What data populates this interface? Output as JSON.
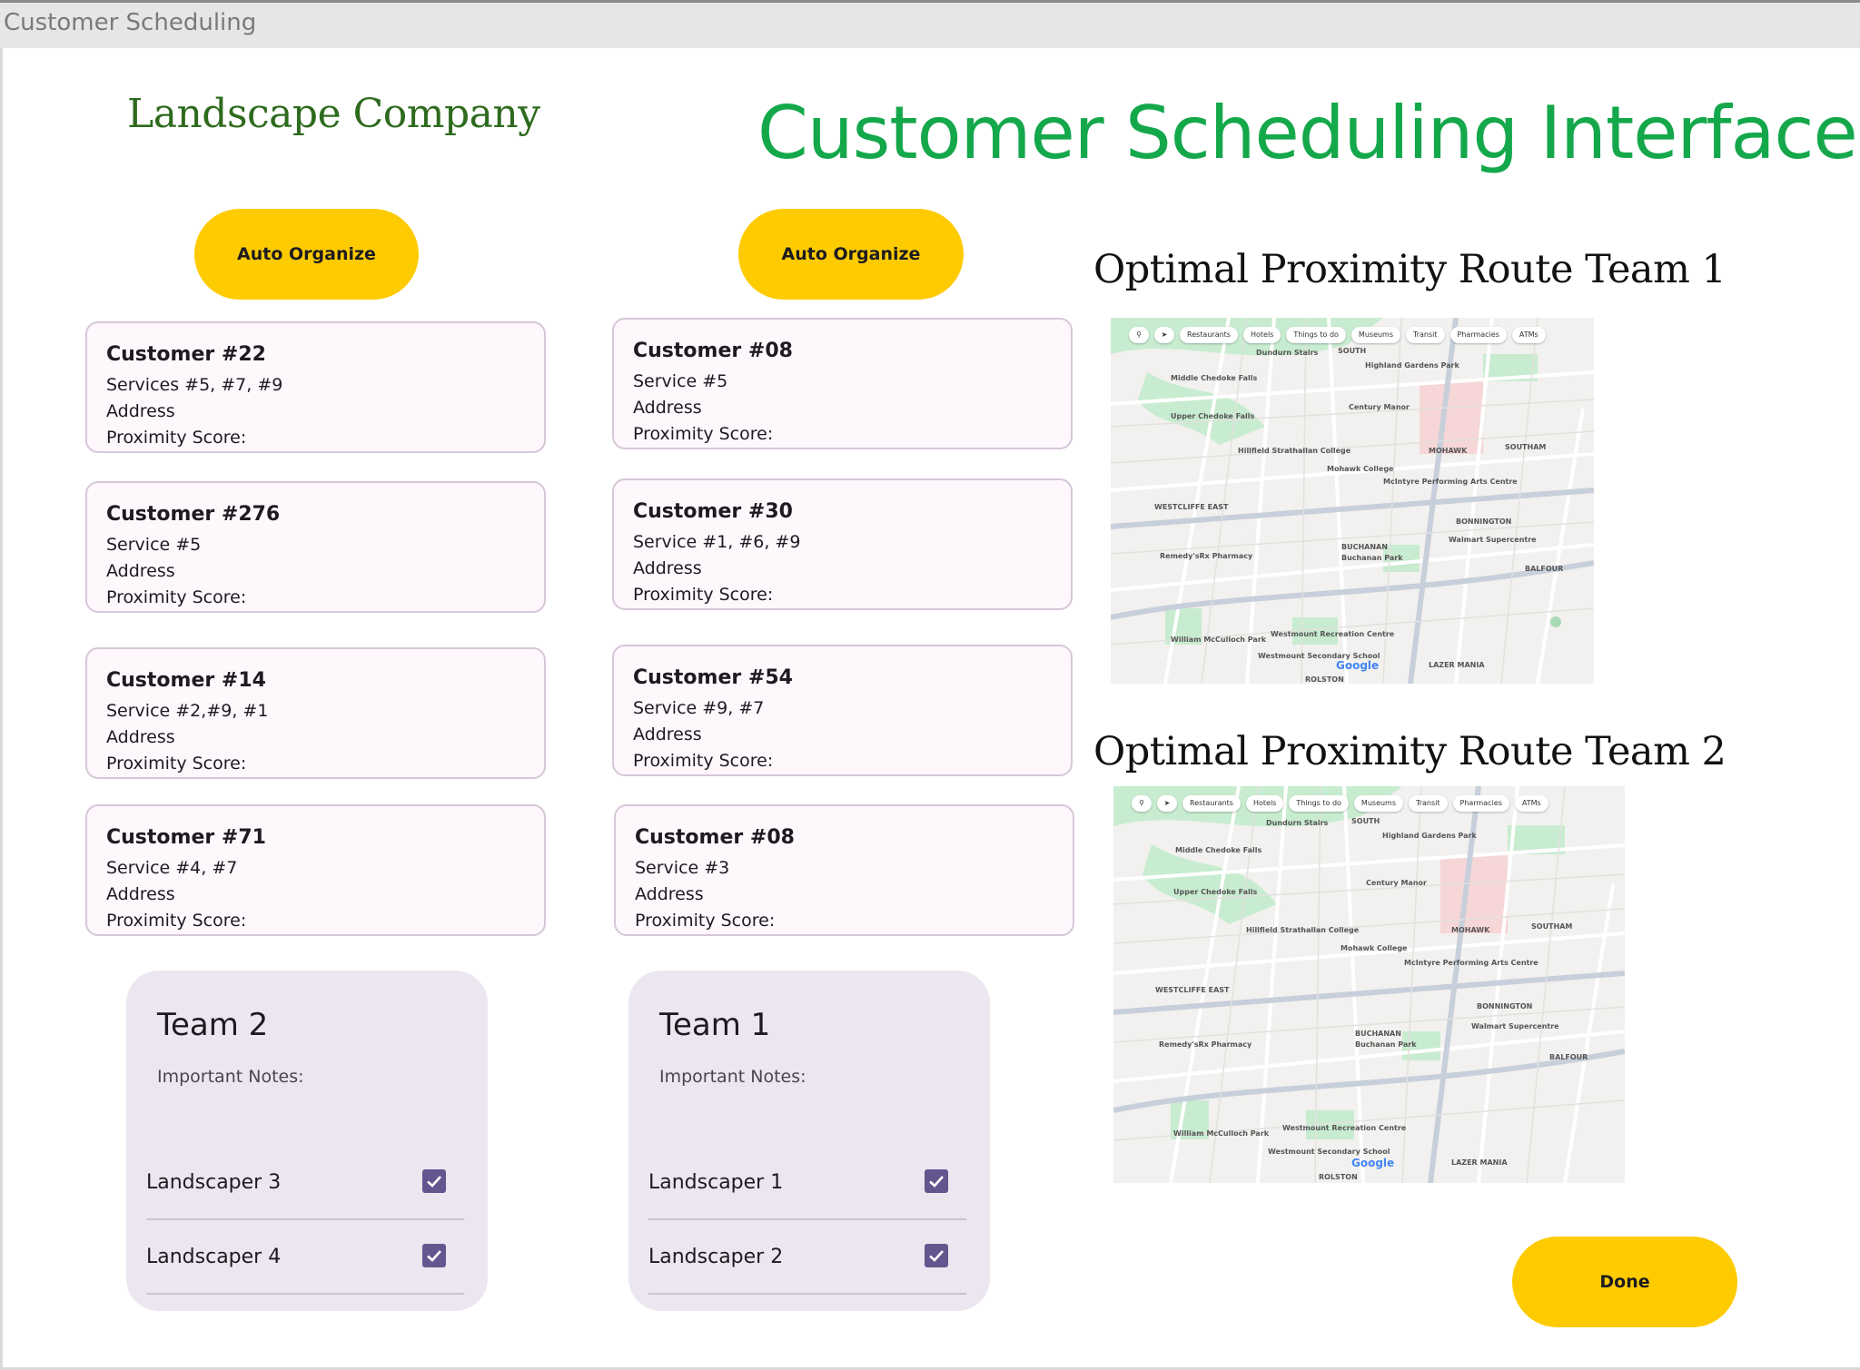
{
  "window": {
    "title": "Customer Scheduling"
  },
  "header": {
    "brand": "Landscape Company",
    "title": "Customer Scheduling Interface"
  },
  "columns": [
    {
      "auto_organize_label": "Auto Organize",
      "customers": [
        {
          "title": "Customer #22",
          "services": "Services #5, #7, #9",
          "address": "Address",
          "proximity": "Proximity Score:"
        },
        {
          "title": "Customer #276",
          "services": "Service #5",
          "address": "Address",
          "proximity": "Proximity Score:"
        },
        {
          "title": "Customer #14",
          "services": "Service #2,#9, #1",
          "address": "Address",
          "proximity": "Proximity Score:"
        },
        {
          "title": "Customer #71",
          "services": "Service #4, #7",
          "address": "Address",
          "proximity": "Proximity Score:"
        }
      ],
      "team": {
        "name": "Team 2",
        "notes_label": "Important Notes:",
        "members": [
          {
            "name": "Landscaper 3",
            "checked": true
          },
          {
            "name": "Landscaper 4",
            "checked": true
          }
        ]
      }
    },
    {
      "auto_organize_label": "Auto Organize",
      "customers": [
        {
          "title": "Customer #08",
          "services": "Service #5",
          "address": "Address",
          "proximity": "Proximity Score:"
        },
        {
          "title": "Customer #30",
          "services": "Service #1, #6, #9",
          "address": "Address",
          "proximity": "Proximity Score:"
        },
        {
          "title": "Customer #54",
          "services": "Service #9, #7",
          "address": "Address",
          "proximity": "Proximity Score:"
        },
        {
          "title": "Customer #08",
          "services": "Service #3",
          "address": "Address",
          "proximity": "Proximity Score:"
        }
      ],
      "team": {
        "name": "Team 1",
        "notes_label": "Important Notes:",
        "members": [
          {
            "name": "Landscaper 1",
            "checked": true
          },
          {
            "name": "Landscaper 2",
            "checked": true
          }
        ]
      }
    }
  ],
  "routes": [
    {
      "title": "Optimal Proximity Route Team 1"
    },
    {
      "title": "Optimal Proximity Route Team 2"
    }
  ],
  "map": {
    "chips": [
      "Restaurants",
      "Hotels",
      "Things to do",
      "Museums",
      "Transit",
      "Pharmacies",
      "ATMs"
    ],
    "places": [
      "Dundurn Stairs",
      "Middle Chedoke Falls",
      "Upper Chedoke Falls",
      "Century Manor",
      "Hillfield Strathallan College",
      "Mohawk College",
      "McIntyre Performing Arts Centre",
      "WESTCLIFFE EAST",
      "BONNINGTON",
      "Walmart Supercentre",
      "Remedy'sRx Pharmacy",
      "BUCHANAN",
      "Buchanan Park",
      "BALFOUR",
      "William McCulloch Park",
      "Westmount Recreation Centre",
      "Westmount Secondary School",
      "LAZER MANIA",
      "ROLSTON",
      "SOUTHAM",
      "MOHAWK",
      "SOUTH",
      "Highland Gardens Park"
    ],
    "logo": "Google",
    "colors": {
      "park": "#c8ecd0",
      "road": "#ffffff",
      "land": "#f2f1ef",
      "hospital": "#f6d6d6",
      "highway": "#c7cfdb"
    }
  },
  "footer": {
    "done_label": "Done"
  },
  "colors": {
    "accent": "#fecb00",
    "title_green": "#14a84b",
    "brand_green": "#2e6b1e",
    "card_bg": "#fef7fc",
    "team_bg": "#ece6f0",
    "checkbox": "#65558f"
  }
}
